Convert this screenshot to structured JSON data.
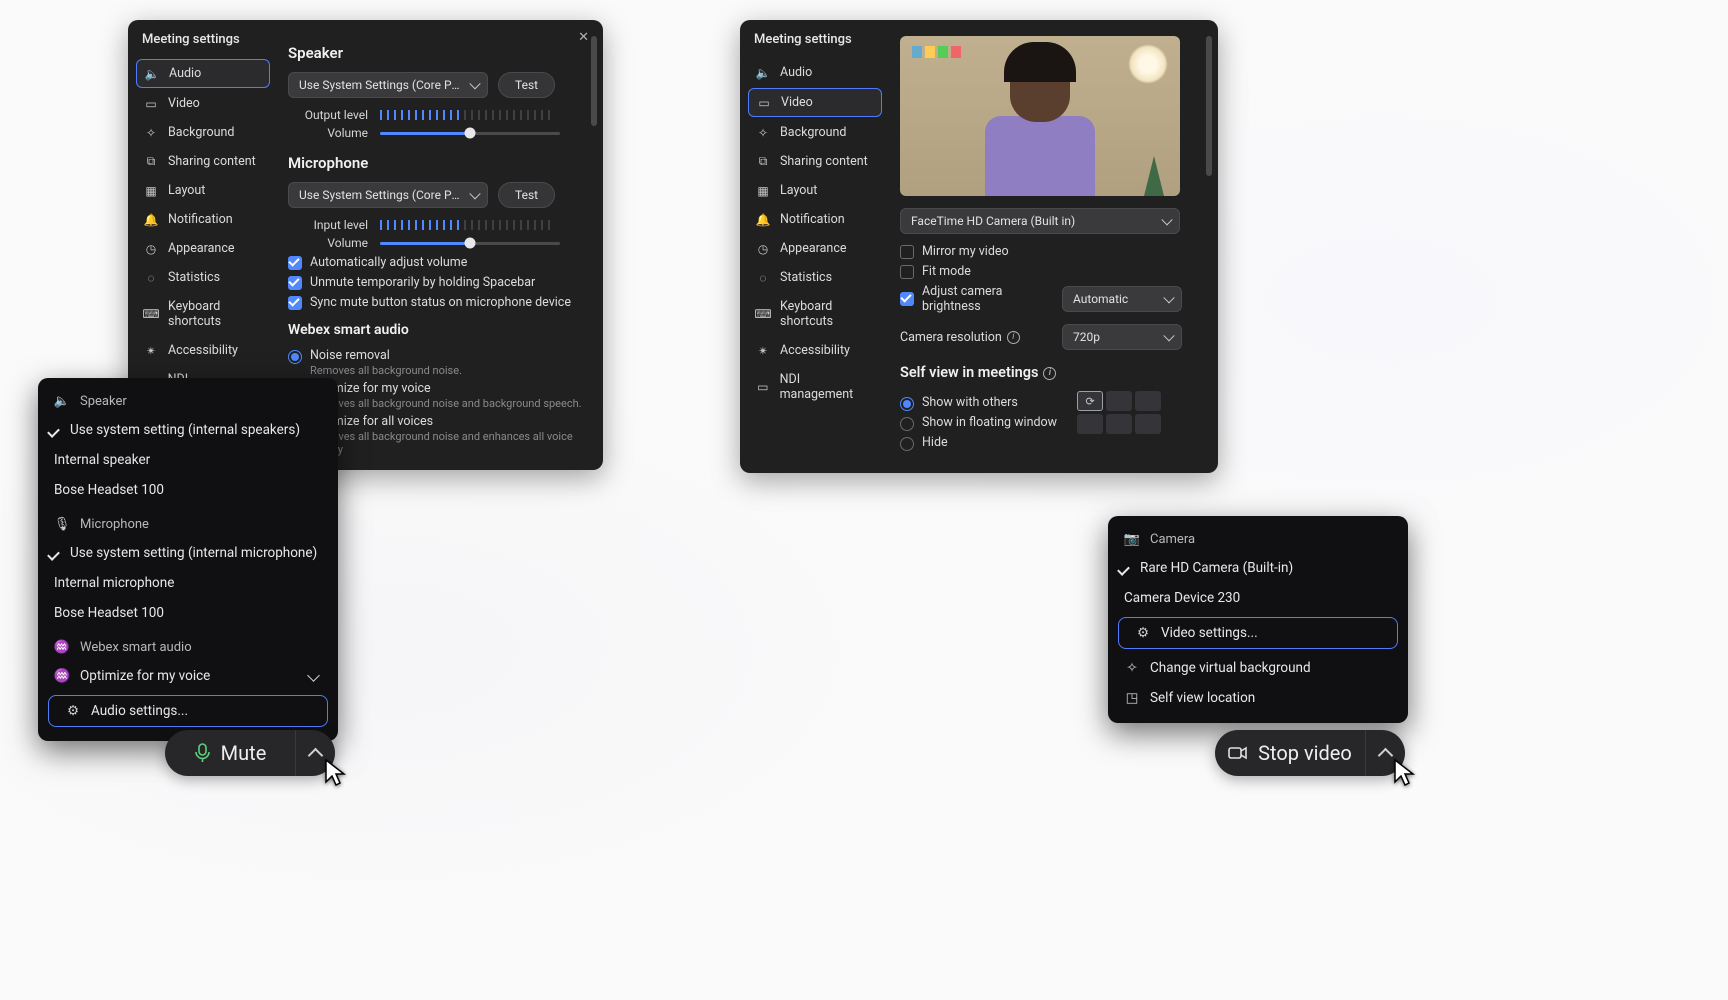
{
  "audio_panel": {
    "title": "Meeting settings",
    "nav": [
      "Audio",
      "Video",
      "Background",
      "Sharing content",
      "Layout",
      "Notification",
      "Appearance",
      "Statistics",
      "Keyboard shortcuts",
      "Accessibility",
      "NDI management"
    ],
    "active_nav": "Audio",
    "speaker": {
      "heading": "Speaker",
      "device": "Use System Settings (Core Processor…",
      "test": "Test",
      "output_label": "Output level",
      "volume_label": "Volume"
    },
    "microphone": {
      "heading": "Microphone",
      "device": "Use System Settings (Core Processor…",
      "test": "Test",
      "input_label": "Input level",
      "volume_label": "Volume",
      "auto_adjust": "Automatically adjust volume",
      "unmute_space": "Unmute temporarily by holding Spacebar",
      "sync_mute": "Sync mute button status on microphone device"
    },
    "smart_audio": {
      "heading": "Webex smart audio",
      "options": [
        {
          "label": "Noise removal",
          "sub": "Removes all background noise."
        },
        {
          "label": "Optimize for my voice",
          "sub": "Removes all background noise and background speech."
        },
        {
          "label": "Optimize for all voices",
          "sub": "Removes all background noise and enhances all voice nearby"
        }
      ]
    }
  },
  "video_panel": {
    "title": "Meeting settings",
    "nav": [
      "Audio",
      "Video",
      "Background",
      "Sharing content",
      "Layout",
      "Notification",
      "Appearance",
      "Statistics",
      "Keyboard shortcuts",
      "Accessibility",
      "NDI management"
    ],
    "active_nav": "Video",
    "camera_device": "FaceTime HD Camera (Built in)",
    "mirror": "Mirror my video",
    "fit": "Fit mode",
    "adjust_brightness": "Adjust camera brightness",
    "brightness_mode": "Automatic",
    "resolution_label": "Camera resolution",
    "resolution": "720p",
    "self_view": {
      "heading": "Self view in meetings",
      "options": [
        "Show with others",
        "Show in floating window",
        "Hide"
      ]
    }
  },
  "audio_popup": {
    "speaker_section": "Speaker",
    "speaker_options": [
      "Use system setting (internal speakers)",
      "Internal speaker",
      "Bose Headset 100"
    ],
    "mic_section": "Microphone",
    "mic_options": [
      "Use system setting (internal microphone)",
      "Internal microphone",
      "Bose Headset 100"
    ],
    "smart_section": "Webex smart audio",
    "smart_option": "Optimize for my voice",
    "settings_link": "Audio settings..."
  },
  "video_popup": {
    "section": "Camera",
    "options": [
      "Rare HD Camera (Built-in)",
      "Camera Device 230"
    ],
    "settings_link": "Video settings...",
    "change_bg": "Change virtual background",
    "self_view": "Self view location"
  },
  "buttons": {
    "mute": "Mute",
    "stop_video": "Stop video"
  }
}
